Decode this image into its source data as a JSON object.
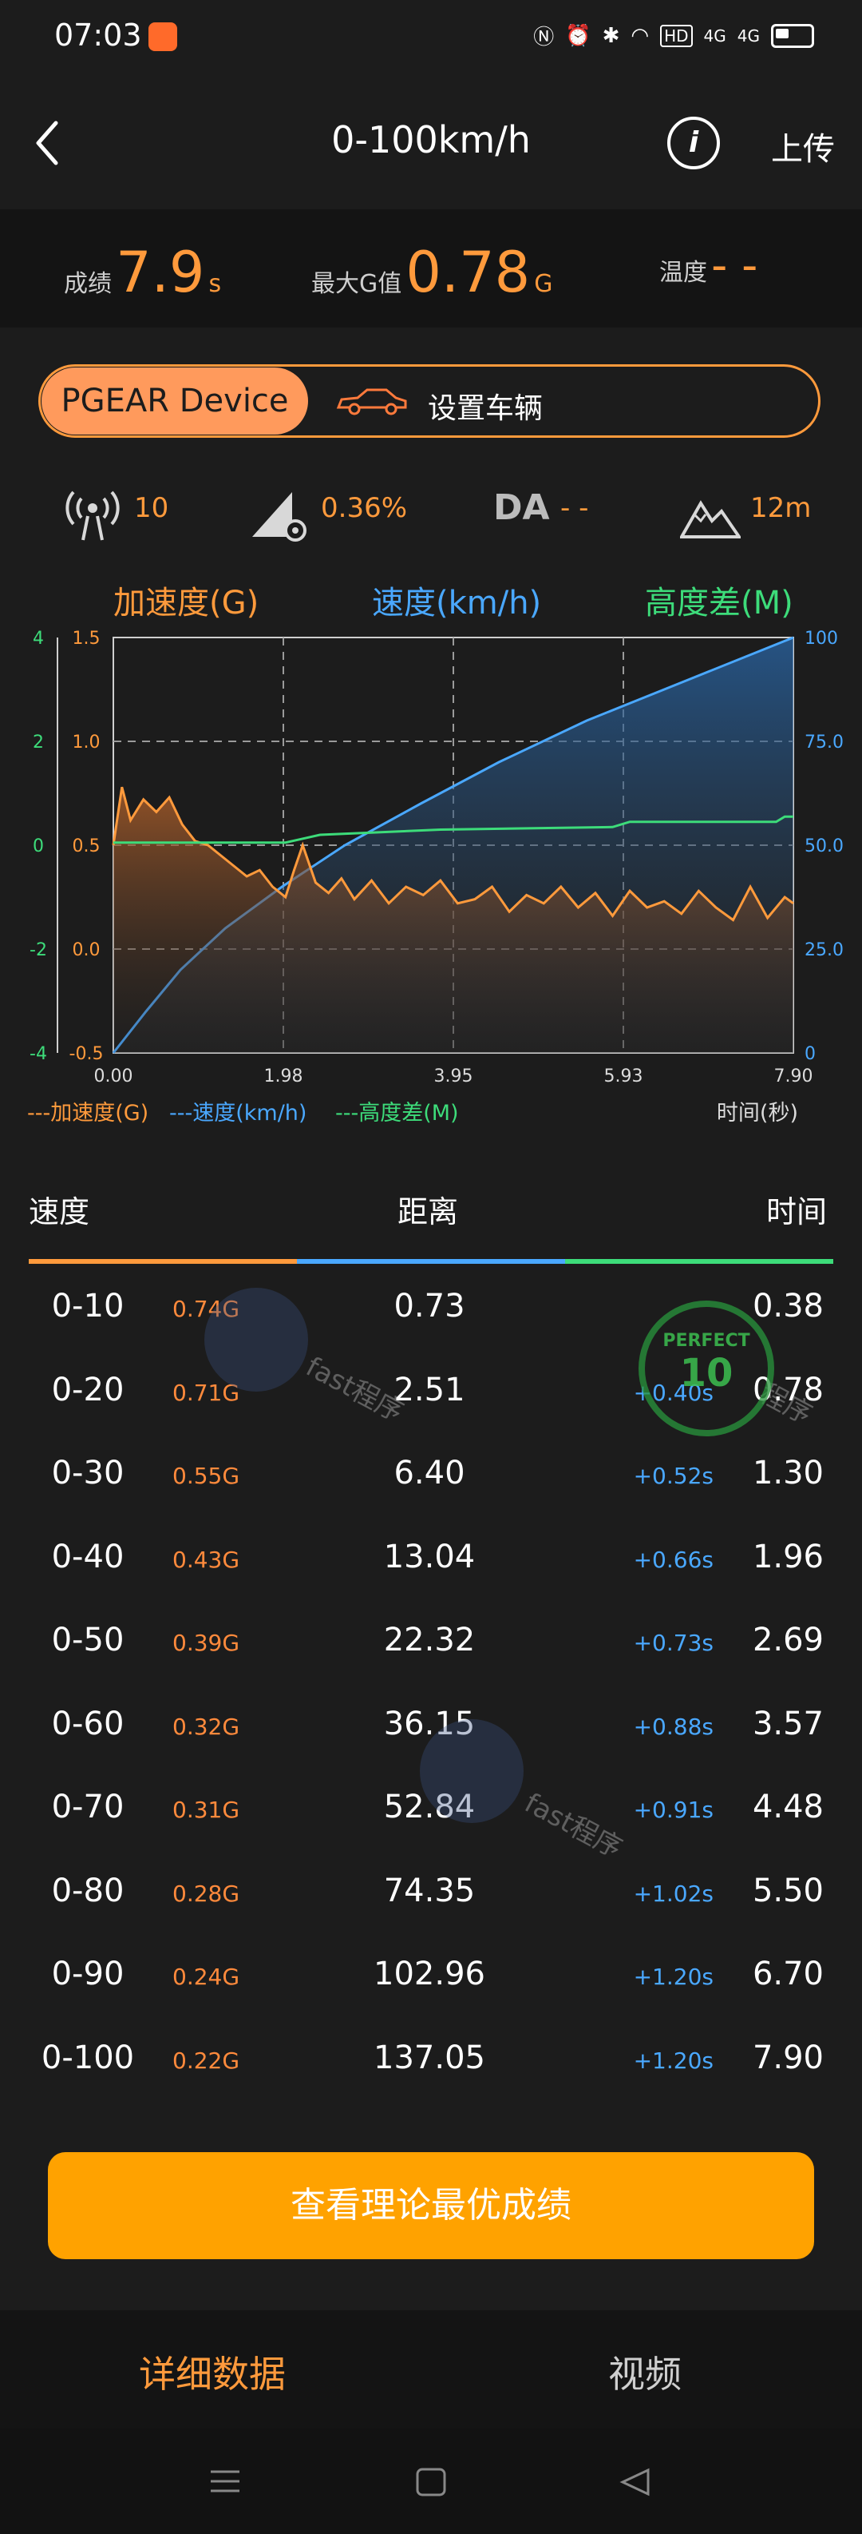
{
  "status": {
    "time": "07:03",
    "icons": [
      "nfc-icon",
      "alarm-icon",
      "bluetooth-icon",
      "wifi-icon",
      "hd-icon",
      "4g-signal-icon",
      "4g-signal-icon",
      "battery-icon"
    ],
    "hd_label": "HD",
    "signal1_label": "4G",
    "signal2_label": "4G"
  },
  "header": {
    "title": "0-100km/h",
    "info_label": "i",
    "upload_label": "上传"
  },
  "stats": {
    "score_label": "成绩",
    "score_value": "7.9",
    "score_unit": "s",
    "maxg_label": "最大G值",
    "maxg_value": "0.78",
    "maxg_unit": "G",
    "temp_label": "温度",
    "temp_value": "- -"
  },
  "device": {
    "device_label": "PGEAR Device",
    "vehicle_label": "设置车辆"
  },
  "metrics": {
    "satellites": "10",
    "slope": "0.36%",
    "da_label": "DA",
    "da_value": "- -",
    "altitude": "12m"
  },
  "chart_legend": {
    "accel": "加速度(G)",
    "speed": "速度(km/h)",
    "altitude": "高度差(M)"
  },
  "chart_data": {
    "type": "line",
    "x_ticks": [
      "0.00",
      "1.98",
      "3.95",
      "5.93",
      "7.90"
    ],
    "xlim": [
      0,
      7.9
    ],
    "xlabel": "时间(秒)",
    "y_left_outer_ticks": [
      "4",
      "2",
      "0",
      "-2",
      "-4"
    ],
    "y_left_inner_ticks": [
      "1.5",
      "1.0",
      "0.5",
      "0.0",
      "-0.5"
    ],
    "y_right_ticks": [
      "100",
      "75.0",
      "50.0",
      "25.0",
      "0"
    ],
    "legend": [
      "---加速度(G)",
      "---速度(km/h)",
      "---高度差(M)"
    ],
    "series": [
      {
        "name": "加速度(G)",
        "axis": "accel",
        "ylim": [
          -0.5,
          1.5
        ],
        "x": [
          0,
          0.1,
          0.2,
          0.35,
          0.5,
          0.65,
          0.8,
          0.95,
          1.1,
          1.25,
          1.4,
          1.55,
          1.7,
          1.85,
          2.0,
          2.1,
          2.2,
          2.35,
          2.5,
          2.65,
          2.8,
          3.0,
          3.2,
          3.4,
          3.6,
          3.8,
          4.0,
          4.2,
          4.4,
          4.6,
          4.8,
          5.0,
          5.2,
          5.4,
          5.6,
          5.8,
          6.0,
          6.2,
          6.4,
          6.6,
          6.8,
          7.0,
          7.2,
          7.4,
          7.6,
          7.8,
          7.9
        ],
        "y": [
          0.5,
          0.78,
          0.62,
          0.72,
          0.66,
          0.73,
          0.6,
          0.52,
          0.5,
          0.45,
          0.4,
          0.35,
          0.38,
          0.3,
          0.25,
          0.38,
          0.5,
          0.32,
          0.27,
          0.34,
          0.24,
          0.33,
          0.22,
          0.3,
          0.26,
          0.33,
          0.22,
          0.24,
          0.3,
          0.18,
          0.26,
          0.22,
          0.3,
          0.2,
          0.27,
          0.16,
          0.28,
          0.2,
          0.23,
          0.17,
          0.28,
          0.2,
          0.14,
          0.3,
          0.15,
          0.25,
          0.22
        ]
      },
      {
        "name": "速度(km/h)",
        "axis": "speed",
        "ylim": [
          0,
          100
        ],
        "x": [
          0.0,
          0.38,
          0.78,
          1.3,
          1.96,
          2.69,
          3.57,
          4.48,
          5.5,
          6.7,
          7.9
        ],
        "y": [
          0,
          10,
          20,
          30,
          40,
          50,
          60,
          70,
          80,
          90,
          100
        ]
      },
      {
        "name": "高度差(M)",
        "axis": "altitude",
        "ylim": [
          -4,
          4
        ],
        "x": [
          0,
          1.0,
          2.0,
          2.4,
          3.8,
          5.8,
          6.0,
          7.7,
          7.8,
          7.9
        ],
        "y": [
          0.05,
          0.05,
          0.05,
          0.2,
          0.3,
          0.35,
          0.45,
          0.45,
          0.55,
          0.55
        ]
      }
    ]
  },
  "table": {
    "col_speed": "速度",
    "col_distance": "距离",
    "col_time": "时间",
    "rows": [
      {
        "range": "0-10",
        "g": "0.74G",
        "distance": "0.73",
        "split": "",
        "time": "0.38"
      },
      {
        "range": "0-20",
        "g": "0.71G",
        "distance": "2.51",
        "split": "+0.40s",
        "time": "0.78"
      },
      {
        "range": "0-30",
        "g": "0.55G",
        "distance": "6.40",
        "split": "+0.52s",
        "time": "1.30"
      },
      {
        "range": "0-40",
        "g": "0.43G",
        "distance": "13.04",
        "split": "+0.66s",
        "time": "1.96"
      },
      {
        "range": "0-50",
        "g": "0.39G",
        "distance": "22.32",
        "split": "+0.73s",
        "time": "2.69"
      },
      {
        "range": "0-60",
        "g": "0.32G",
        "distance": "36.15",
        "split": "+0.88s",
        "time": "3.57"
      },
      {
        "range": "0-70",
        "g": "0.31G",
        "distance": "52.84",
        "split": "+0.91s",
        "time": "4.48"
      },
      {
        "range": "0-80",
        "g": "0.28G",
        "distance": "74.35",
        "split": "+1.02s",
        "time": "5.50"
      },
      {
        "range": "0-90",
        "g": "0.24G",
        "distance": "102.96",
        "split": "+1.20s",
        "time": "6.70"
      },
      {
        "range": "0-100",
        "g": "0.22G",
        "distance": "137.05",
        "split": "+1.20s",
        "time": "7.90"
      }
    ]
  },
  "watermarks": {
    "text1": "fast程序",
    "text2": "fast程序",
    "text3": "程序",
    "stamp_number": "10",
    "stamp_text": "PERFECT"
  },
  "cta": {
    "label": "查看理论最优成绩"
  },
  "tabs": {
    "detail": "详细数据",
    "video": "视频"
  },
  "colors": {
    "accent": "#ff9a3c",
    "speed": "#4aa8ff",
    "altitude": "#3ddc7a",
    "cta": "#ffa200"
  }
}
